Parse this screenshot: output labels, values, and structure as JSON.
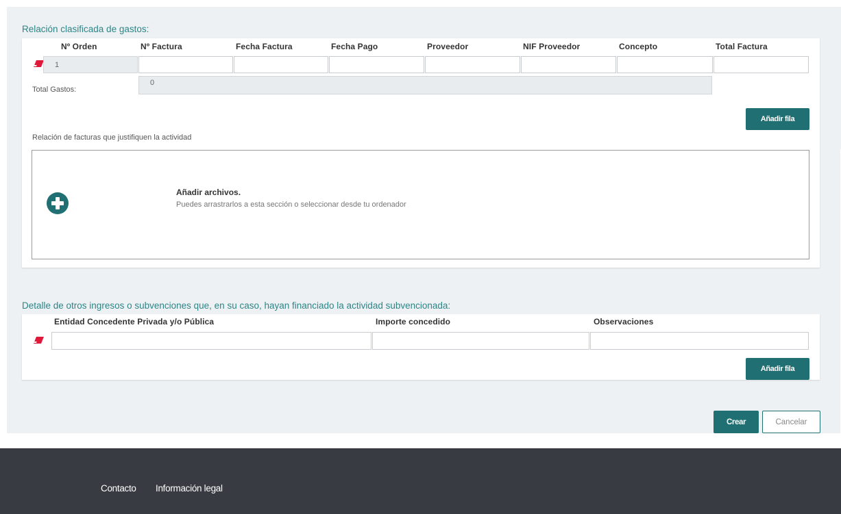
{
  "expenses": {
    "section_title": "Relación clasificada de gastos:",
    "columns": [
      "Nº Orden",
      "Nº Factura",
      "Fecha Factura",
      "Fecha Pago",
      "Proveedor",
      "NIF Proveedor",
      "Concepto",
      "Total Factura"
    ],
    "rows": [
      {
        "order": "1",
        "invoice_no": "",
        "invoice_date": "",
        "payment_date": "",
        "supplier": "",
        "supplier_nif": "",
        "concept": "",
        "total": ""
      }
    ],
    "total_label": "Total Gastos:",
    "total_value": "0",
    "add_row_label": "Añadir fila"
  },
  "invoices": {
    "label": "Relación de facturas que justifiquen la actividad",
    "dropzone_title": "Añadir archivos.",
    "dropzone_hint": "Puedes arrastrarlos a esta sección o seleccionar desde tu ordenador"
  },
  "other_income": {
    "section_title": "Detalle de otros ingresos o subvenciones que, en su caso, hayan financiado la actividad subvencionada:",
    "columns": [
      "Entidad Concedente Privada y/o Pública",
      "Importe concedido",
      "Observaciones"
    ],
    "rows": [
      {
        "entity": "",
        "amount": "",
        "observations": ""
      }
    ],
    "add_row_label": "Añadir fila"
  },
  "actions": {
    "create_label": "Crear",
    "cancel_label": "Cancelar"
  },
  "footer": {
    "links": [
      "Contacto",
      "Información legal"
    ]
  },
  "colors": {
    "accent": "#1f6f73",
    "section_title": "#2b8586",
    "eraser": "#e0193a",
    "footer_bg": "#383c42",
    "form_bg": "#eef1f4"
  },
  "icons": {
    "row_delete": "eraser-icon",
    "add_file": "plus-circle-icon"
  }
}
